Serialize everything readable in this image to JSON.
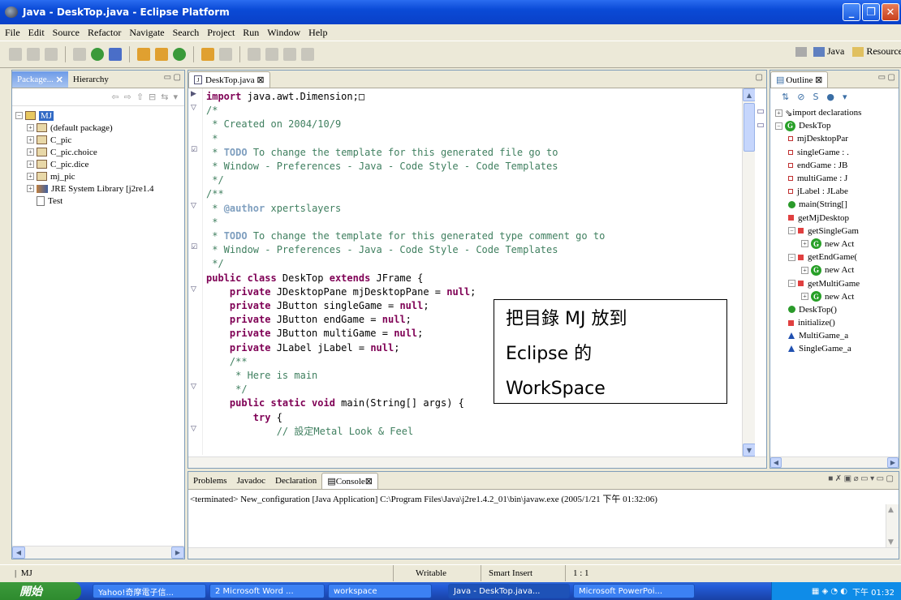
{
  "window": {
    "title": "Java - DeskTop.java - Eclipse Platform"
  },
  "menu": [
    "File",
    "Edit",
    "Source",
    "Refactor",
    "Navigate",
    "Search",
    "Project",
    "Run",
    "Window",
    "Help"
  ],
  "perspectives": {
    "java": "Java",
    "resource": "Resource"
  },
  "left_tabs": {
    "package": "Package...",
    "hierarchy": "Hierarchy"
  },
  "package_tree": {
    "root": "MJ",
    "items": [
      "(default package)",
      "C_pic",
      "C_pic.choice",
      "C_pic.dice",
      "mj_pic",
      "JRE System Library [j2re1.4",
      "Test"
    ]
  },
  "editor": {
    "tab": "DeskTop.java",
    "lines": [
      {
        "k": "import",
        "t": " java.awt.Dimension;"
      },
      {
        "c": "/*"
      },
      {
        "c": " * Created on 2004/10/9"
      },
      {
        "c": " *"
      },
      {
        "c": " * TODO To change the template for this generated file go to"
      },
      {
        "c": " * Window - Preferences - Java - Code Style - Code Templates"
      },
      {
        "c": " */"
      },
      {
        "t": ""
      },
      {
        "c": "/**"
      },
      {
        "c": " * @author xpertslayers"
      },
      {
        "c": " *"
      },
      {
        "c": " * TODO To change the template for this generated type comment go to"
      },
      {
        "c": " * Window - Preferences - Java - Code Style - Code Templates"
      },
      {
        "c": " */"
      },
      {
        "k": "public class",
        "t": " DeskTop ",
        "k2": "extends",
        "t2": " JFrame {"
      },
      {
        "t": ""
      },
      {
        "t": "    ",
        "k": "private",
        "t2": " JDesktopPane mjDesktopPane = ",
        "k2": "null",
        "t3": ";"
      },
      {
        "t": "    ",
        "k": "private",
        "t2": " JButton singleGame = ",
        "k2": "null",
        "t3": ";"
      },
      {
        "t": "    ",
        "k": "private",
        "t2": " JButton endGame = ",
        "k2": "null",
        "t3": ";"
      },
      {
        "t": "    ",
        "k": "private",
        "t2": " JButton multiGame = ",
        "k2": "null",
        "t3": ";"
      },
      {
        "t": "    ",
        "k": "private",
        "t2": " JLabel jLabel = ",
        "k2": "null",
        "t3": ";"
      },
      {
        "c": "    /**"
      },
      {
        "c": "     * Here is main"
      },
      {
        "c": "     */"
      },
      {
        "t": "    ",
        "k": "public static void",
        "t2": " main(String[] args) {"
      },
      {
        "t": "        ",
        "k": "try",
        "t2": " {"
      },
      {
        "c": "            // 設定Metal Look & Feel"
      }
    ]
  },
  "outline": {
    "tab": "Outline",
    "items": [
      "import declarations",
      "DeskTop",
      "mjDesktopPar",
      "singleGame : .",
      "endGame : JB",
      "multiGame : J",
      "jLabel : JLabe",
      "main(String[]",
      "getMjDesktop",
      "getSingleGam",
      "new Act",
      "getEndGame(",
      "new Act",
      "getMultiGame",
      "new Act",
      "DeskTop()",
      "initialize()",
      "MultiGame_a",
      "SingleGame_a"
    ]
  },
  "bottom_tabs": [
    "Problems",
    "Javadoc",
    "Declaration",
    "Console"
  ],
  "console": {
    "status": "<terminated> New_configuration [Java Application] C:\\Program Files\\Java\\j2re1.4.2_01\\bin\\javaw.exe (2005/1/21 下午 01:32:06)"
  },
  "statusbar": {
    "left": "MJ",
    "writable": "Writable",
    "insert": "Smart Insert",
    "pos": "1 : 1"
  },
  "taskbar": {
    "start": "開始",
    "buttons": [
      "Yahoo!奇摩電子信...",
      "2 Microsoft Word ...",
      "workspace",
      "Java - DeskTop.java...",
      "Microsoft PowerPoi..."
    ],
    "clock": "下午 01:32"
  },
  "overlay": {
    "line1": "把目錄 MJ  放到",
    "line2": "Eclipse  的",
    "line3": "WorkSpace"
  }
}
